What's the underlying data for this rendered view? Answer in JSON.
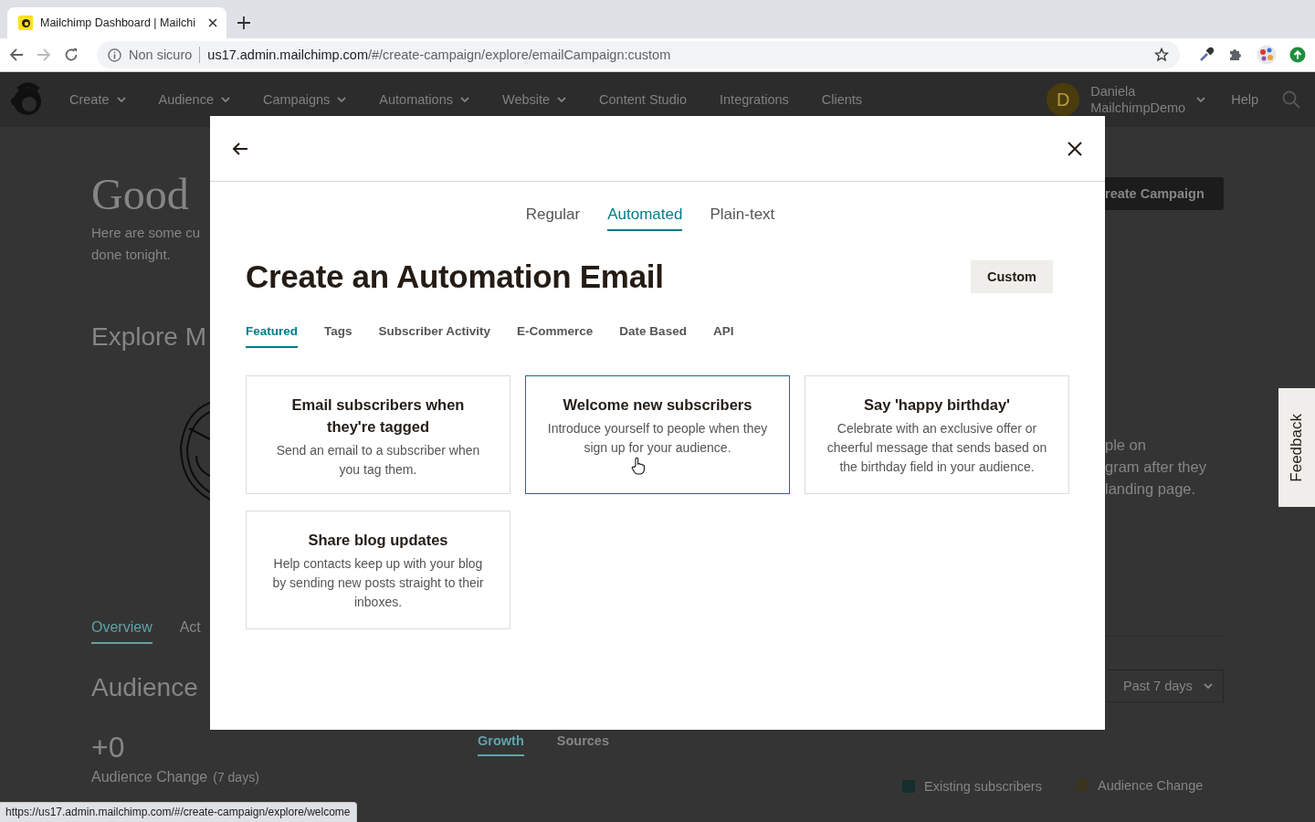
{
  "browser": {
    "tab_title": "Mailchimp Dashboard | Mailchi",
    "security_label": "Non sicuro",
    "url_host": "us17.admin.mailchimp.com",
    "url_path": "/#/create-campaign/explore/emailCampaign:custom"
  },
  "nav": {
    "items": [
      {
        "label": "Create",
        "has_menu": true
      },
      {
        "label": "Audience",
        "has_menu": true
      },
      {
        "label": "Campaigns",
        "has_menu": true
      },
      {
        "label": "Automations",
        "has_menu": true
      },
      {
        "label": "Website",
        "has_menu": true
      },
      {
        "label": "Content Studio",
        "has_menu": false
      },
      {
        "label": "Integrations",
        "has_menu": false
      },
      {
        "label": "Clients",
        "has_menu": false
      }
    ],
    "user": {
      "initial": "D",
      "first_line": "Daniela",
      "second_line": "MailchimpDemo"
    },
    "help": "Help"
  },
  "dashboard": {
    "greeting": "Good",
    "intro_lines": [
      "Here are some cu",
      "done tonight."
    ],
    "explore_heading": "Explore M",
    "create_campaign": "reate Campaign",
    "promo_lines": [
      "ple on",
      "gram after they",
      "landing page."
    ],
    "tabs": [
      {
        "label": "Overview",
        "selected": true
      },
      {
        "label": "Act",
        "selected": false
      }
    ],
    "section_heading": "Audience",
    "change_value": "+0",
    "change_label": "Audience Change",
    "change_period": "(7 days)",
    "chart_tabs": [
      {
        "label": "Growth",
        "selected": true
      },
      {
        "label": "Sources",
        "selected": false
      }
    ],
    "range": "Past 7 days",
    "legend": [
      {
        "label": "Existing subscribers",
        "color": "#142e2e"
      },
      {
        "label": "Audience Change",
        "color": "#3a3320"
      }
    ]
  },
  "modal": {
    "tabs": [
      {
        "label": "Regular",
        "selected": false
      },
      {
        "label": "Automated",
        "selected": true
      },
      {
        "label": "Plain-text",
        "selected": false
      }
    ],
    "title": "Create an Automation Email",
    "custom_button": "Custom",
    "categories": [
      {
        "label": "Featured",
        "selected": true
      },
      {
        "label": "Tags",
        "selected": false
      },
      {
        "label": "Subscriber Activity",
        "selected": false
      },
      {
        "label": "E-Commerce",
        "selected": false
      },
      {
        "label": "Date Based",
        "selected": false
      },
      {
        "label": "API",
        "selected": false
      }
    ],
    "cards": [
      {
        "title": "Email subscribers when they're tagged",
        "description": "Send an email to a subscriber when you tag them.",
        "selected": false
      },
      {
        "title": "Welcome new subscribers",
        "description": "Introduce yourself to people when they sign up for your audience.",
        "selected": true
      },
      {
        "title": "Say 'happy birthday'",
        "description": "Celebrate with an exclusive offer or cheerful message that sends based on the birthday field in your audience.",
        "selected": false
      },
      {
        "title": "Share blog updates",
        "description": "Help contacts keep up with your blog by sending new posts straight to their inboxes.",
        "selected": false
      }
    ]
  },
  "feedback": "Feedback",
  "status_url": "https://us17.admin.mailchimp.com/#/create-campaign/explore/welcome"
}
